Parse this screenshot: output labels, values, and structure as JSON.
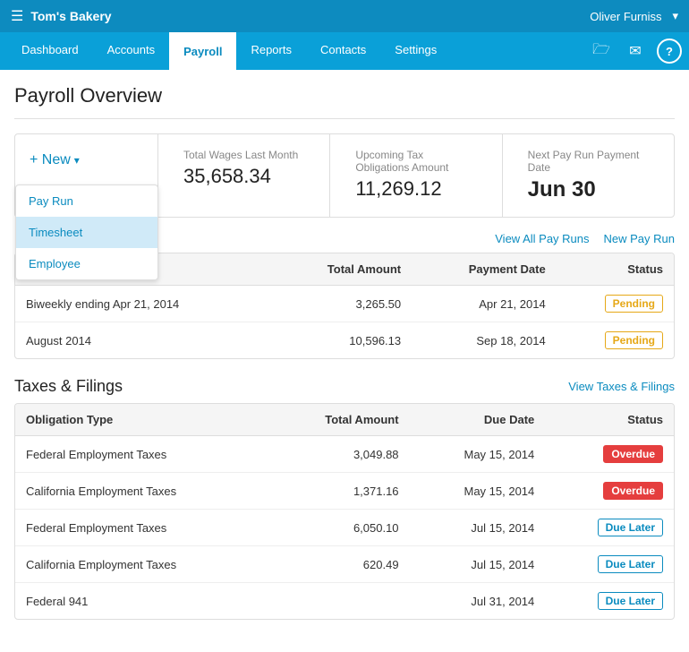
{
  "app": {
    "name": "Tom's Bakery",
    "user": "Oliver Furniss"
  },
  "nav": {
    "items": [
      {
        "label": "Dashboard",
        "active": false
      },
      {
        "label": "Accounts",
        "active": false
      },
      {
        "label": "Payroll",
        "active": true
      },
      {
        "label": "Reports",
        "active": false
      },
      {
        "label": "Contacts",
        "active": false
      },
      {
        "label": "Settings",
        "active": false
      }
    ]
  },
  "page": {
    "title": "Payroll Overview"
  },
  "stats": {
    "new_label": "+ New",
    "caret": "▾",
    "total_wages_label": "Total Wages Last Month",
    "total_wages_value": "35,658.34",
    "tax_obligations_label": "Upcoming Tax Obligations Amount",
    "tax_obligations_value": "11,269.12",
    "next_pay_label": "Next Pay Run Payment Date",
    "next_pay_value": "Jun 30"
  },
  "dropdown": {
    "items": [
      {
        "label": "Pay Run",
        "highlighted": false
      },
      {
        "label": "Timesheet",
        "highlighted": true
      },
      {
        "label": "Employee",
        "highlighted": false
      }
    ]
  },
  "pay_runs": {
    "section_links": [
      {
        "label": "View All Pay Runs"
      },
      {
        "label": "New Pay Run"
      }
    ],
    "columns": [
      "",
      "Total Amount",
      "Payment Date",
      "Status"
    ],
    "rows": [
      {
        "description": "Biweekly ending Apr 21, 2014",
        "total_amount": "3,265.50",
        "payment_date": "Apr 21, 2014",
        "status": "Pending",
        "status_type": "pending"
      },
      {
        "description": "August 2014",
        "total_amount": "10,596.13",
        "payment_date": "Sep 18, 2014",
        "status": "Pending",
        "status_type": "pending"
      }
    ]
  },
  "taxes": {
    "section_title": "Taxes & Filings",
    "link_label": "View Taxes & Filings",
    "columns": [
      "Obligation Type",
      "Total Amount",
      "Due Date",
      "Status"
    ],
    "rows": [
      {
        "type": "Federal Employment Taxes",
        "total_amount": "3,049.88",
        "due_date": "May 15, 2014",
        "status": "Overdue",
        "status_type": "overdue"
      },
      {
        "type": "California Employment Taxes",
        "total_amount": "1,371.16",
        "due_date": "May 15, 2014",
        "status": "Overdue",
        "status_type": "overdue"
      },
      {
        "type": "Federal Employment Taxes",
        "total_amount": "6,050.10",
        "due_date": "Jul 15, 2014",
        "status": "Due Later",
        "status_type": "due-later"
      },
      {
        "type": "California Employment Taxes",
        "total_amount": "620.49",
        "due_date": "Jul 15, 2014",
        "status": "Due Later",
        "status_type": "due-later"
      },
      {
        "type": "Federal 941",
        "total_amount": "",
        "due_date": "Jul 31, 2014",
        "status": "Due Later",
        "status_type": "due-later"
      }
    ]
  }
}
